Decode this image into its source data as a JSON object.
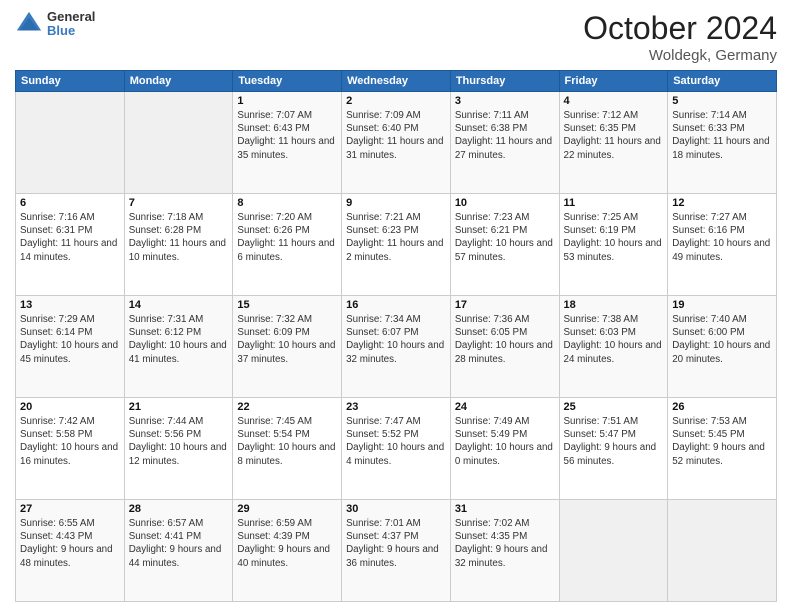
{
  "header": {
    "logo_line1": "General",
    "logo_line2": "Blue",
    "month": "October 2024",
    "location": "Woldegk, Germany"
  },
  "weekdays": [
    "Sunday",
    "Monday",
    "Tuesday",
    "Wednesday",
    "Thursday",
    "Friday",
    "Saturday"
  ],
  "weeks": [
    [
      {
        "day": "",
        "info": ""
      },
      {
        "day": "",
        "info": ""
      },
      {
        "day": "1",
        "info": "Sunrise: 7:07 AM\nSunset: 6:43 PM\nDaylight: 11 hours and 35 minutes."
      },
      {
        "day": "2",
        "info": "Sunrise: 7:09 AM\nSunset: 6:40 PM\nDaylight: 11 hours and 31 minutes."
      },
      {
        "day": "3",
        "info": "Sunrise: 7:11 AM\nSunset: 6:38 PM\nDaylight: 11 hours and 27 minutes."
      },
      {
        "day": "4",
        "info": "Sunrise: 7:12 AM\nSunset: 6:35 PM\nDaylight: 11 hours and 22 minutes."
      },
      {
        "day": "5",
        "info": "Sunrise: 7:14 AM\nSunset: 6:33 PM\nDaylight: 11 hours and 18 minutes."
      }
    ],
    [
      {
        "day": "6",
        "info": "Sunrise: 7:16 AM\nSunset: 6:31 PM\nDaylight: 11 hours and 14 minutes."
      },
      {
        "day": "7",
        "info": "Sunrise: 7:18 AM\nSunset: 6:28 PM\nDaylight: 11 hours and 10 minutes."
      },
      {
        "day": "8",
        "info": "Sunrise: 7:20 AM\nSunset: 6:26 PM\nDaylight: 11 hours and 6 minutes."
      },
      {
        "day": "9",
        "info": "Sunrise: 7:21 AM\nSunset: 6:23 PM\nDaylight: 11 hours and 2 minutes."
      },
      {
        "day": "10",
        "info": "Sunrise: 7:23 AM\nSunset: 6:21 PM\nDaylight: 10 hours and 57 minutes."
      },
      {
        "day": "11",
        "info": "Sunrise: 7:25 AM\nSunset: 6:19 PM\nDaylight: 10 hours and 53 minutes."
      },
      {
        "day": "12",
        "info": "Sunrise: 7:27 AM\nSunset: 6:16 PM\nDaylight: 10 hours and 49 minutes."
      }
    ],
    [
      {
        "day": "13",
        "info": "Sunrise: 7:29 AM\nSunset: 6:14 PM\nDaylight: 10 hours and 45 minutes."
      },
      {
        "day": "14",
        "info": "Sunrise: 7:31 AM\nSunset: 6:12 PM\nDaylight: 10 hours and 41 minutes."
      },
      {
        "day": "15",
        "info": "Sunrise: 7:32 AM\nSunset: 6:09 PM\nDaylight: 10 hours and 37 minutes."
      },
      {
        "day": "16",
        "info": "Sunrise: 7:34 AM\nSunset: 6:07 PM\nDaylight: 10 hours and 32 minutes."
      },
      {
        "day": "17",
        "info": "Sunrise: 7:36 AM\nSunset: 6:05 PM\nDaylight: 10 hours and 28 minutes."
      },
      {
        "day": "18",
        "info": "Sunrise: 7:38 AM\nSunset: 6:03 PM\nDaylight: 10 hours and 24 minutes."
      },
      {
        "day": "19",
        "info": "Sunrise: 7:40 AM\nSunset: 6:00 PM\nDaylight: 10 hours and 20 minutes."
      }
    ],
    [
      {
        "day": "20",
        "info": "Sunrise: 7:42 AM\nSunset: 5:58 PM\nDaylight: 10 hours and 16 minutes."
      },
      {
        "day": "21",
        "info": "Sunrise: 7:44 AM\nSunset: 5:56 PM\nDaylight: 10 hours and 12 minutes."
      },
      {
        "day": "22",
        "info": "Sunrise: 7:45 AM\nSunset: 5:54 PM\nDaylight: 10 hours and 8 minutes."
      },
      {
        "day": "23",
        "info": "Sunrise: 7:47 AM\nSunset: 5:52 PM\nDaylight: 10 hours and 4 minutes."
      },
      {
        "day": "24",
        "info": "Sunrise: 7:49 AM\nSunset: 5:49 PM\nDaylight: 10 hours and 0 minutes."
      },
      {
        "day": "25",
        "info": "Sunrise: 7:51 AM\nSunset: 5:47 PM\nDaylight: 9 hours and 56 minutes."
      },
      {
        "day": "26",
        "info": "Sunrise: 7:53 AM\nSunset: 5:45 PM\nDaylight: 9 hours and 52 minutes."
      }
    ],
    [
      {
        "day": "27",
        "info": "Sunrise: 6:55 AM\nSunset: 4:43 PM\nDaylight: 9 hours and 48 minutes."
      },
      {
        "day": "28",
        "info": "Sunrise: 6:57 AM\nSunset: 4:41 PM\nDaylight: 9 hours and 44 minutes."
      },
      {
        "day": "29",
        "info": "Sunrise: 6:59 AM\nSunset: 4:39 PM\nDaylight: 9 hours and 40 minutes."
      },
      {
        "day": "30",
        "info": "Sunrise: 7:01 AM\nSunset: 4:37 PM\nDaylight: 9 hours and 36 minutes."
      },
      {
        "day": "31",
        "info": "Sunrise: 7:02 AM\nSunset: 4:35 PM\nDaylight: 9 hours and 32 minutes."
      },
      {
        "day": "",
        "info": ""
      },
      {
        "day": "",
        "info": ""
      }
    ]
  ]
}
